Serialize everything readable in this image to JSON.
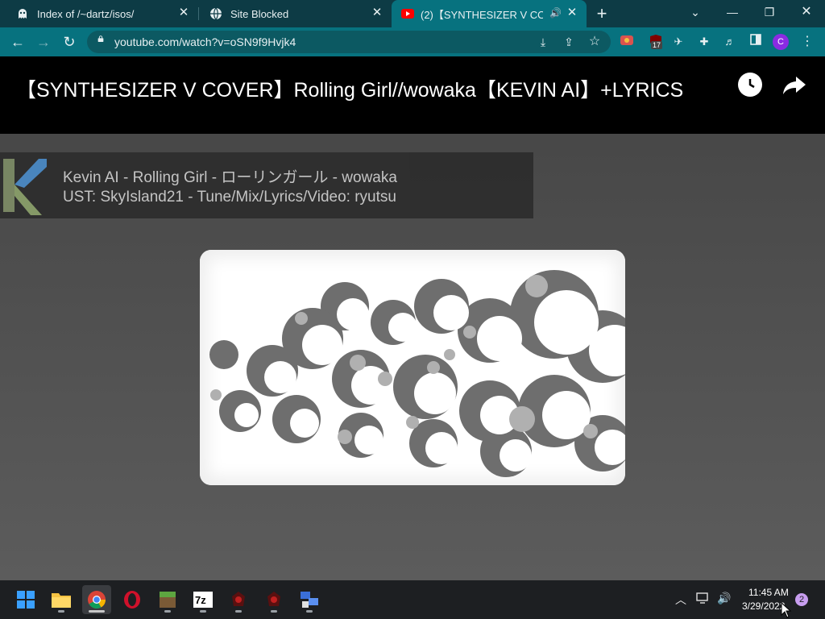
{
  "tabs": [
    {
      "title": "Index of /~dartz/isos/",
      "icon": "ghost-icon"
    },
    {
      "title": "Site Blocked",
      "icon": "globe-icon"
    },
    {
      "title": "(2)【SYNTHESIZER V COVER】Rolling Girl//wowaka【KEVIN AI】+LYRICS",
      "icon": "youtube-icon",
      "active": true,
      "audio": true
    }
  ],
  "toolbar": {
    "url": "youtube.com/watch?v=oSN9f9Hvjk4",
    "extension_badge": "17",
    "profile_initial": "C"
  },
  "video": {
    "title": "【SYNTHESIZER V COVER】Rolling Girl//wowaka【KEVIN AI】+LYRICS",
    "caption_line1": "Kevin AI - Rolling Girl - ローリンガール - wowaka",
    "caption_line2": "UST: SkyIsland21 - Tune/Mix/Lyrics/Video: ryutsu"
  },
  "taskbar": {
    "apps": [
      "start-icon",
      "file-explorer-icon",
      "chrome-icon",
      "opera-icon",
      "minecraft-icon",
      "7zip-icon",
      "app-icon-1",
      "app-icon-2",
      "network-tool-icon"
    ],
    "time": "11:45 AM",
    "date": "3/29/2022",
    "notification_count": "2"
  },
  "colors": {
    "tab_strip": "#0d3b45",
    "toolbar": "#07727f",
    "taskbar": "#1d1f22"
  }
}
